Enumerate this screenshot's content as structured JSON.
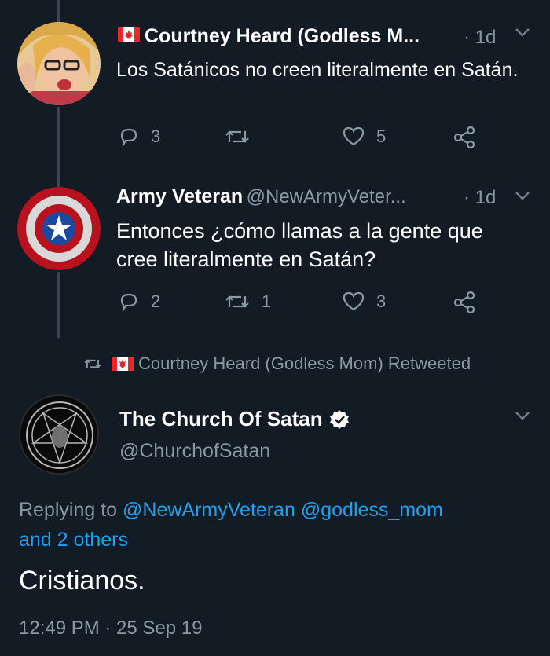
{
  "tweet1": {
    "name": "Courtney Heard (Godless M...",
    "time": "· 1d",
    "text": "Los Satánicos no creen literalmente en Satán.",
    "replies": "3",
    "likes": "5"
  },
  "tweet2": {
    "name": "Army Veteran",
    "handle": "@NewArmyVeter...",
    "time": "· 1d",
    "text_line1": "Entonces ¿cómo llamas a la gente que",
    "text_line2": "cree literalmente en Satán?",
    "replies": "2",
    "retweets": "1",
    "likes": "3"
  },
  "retweet_notice": {
    "text": "Courtney Heard (Godless Mom) Retweeted"
  },
  "tweet3": {
    "name": "The Church Of Satan",
    "handle": "@ChurchofSatan",
    "replying_prefix": "Replying to",
    "replying_mentions": "@NewArmyVeteran @godless_mom",
    "replying_more": "and 2 others",
    "text": "Cristianos.",
    "timestamp": "12:49 PM · 25 Sep 19"
  },
  "icons": {
    "reply": "reply-icon",
    "retweet": "retweet-icon",
    "like": "heart-icon",
    "share": "share-icon",
    "verified": "verified-badge-icon",
    "chevron": "chevron-down-icon",
    "flag": "canada-flag-icon"
  }
}
